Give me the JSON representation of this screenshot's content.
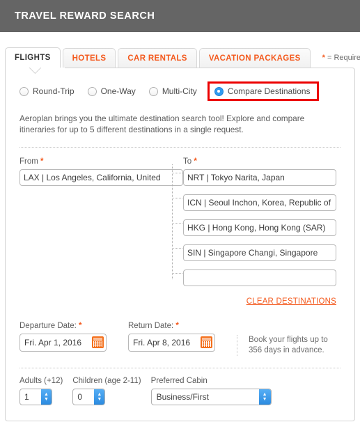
{
  "header": {
    "title": "TRAVEL REWARD SEARCH"
  },
  "tabs": [
    {
      "label": "FLIGHTS",
      "active": true
    },
    {
      "label": "HOTELS",
      "active": false
    },
    {
      "label": "CAR RENTALS",
      "active": false
    },
    {
      "label": "VACATION PACKAGES",
      "active": false
    }
  ],
  "required_note": {
    "star": "*",
    "text": " = Required"
  },
  "trip_types": [
    {
      "label": "Round-Trip",
      "checked": false,
      "highlighted": false
    },
    {
      "label": "One-Way",
      "checked": false,
      "highlighted": false
    },
    {
      "label": "Multi-City",
      "checked": false,
      "highlighted": false
    },
    {
      "label": "Compare Destinations",
      "checked": true,
      "highlighted": true
    }
  ],
  "intro_text": "Aeroplan brings you the ultimate destination search tool! Explore and compare itineraries for up to 5 different destinations in a single request.",
  "from": {
    "label": "From",
    "star": "*",
    "value": "LAX | Los Angeles, California, United",
    "placeholder": ""
  },
  "to": {
    "label": "To",
    "star": "*",
    "destinations": [
      {
        "value": "NRT | Tokyo Narita, Japan",
        "placeholder": ""
      },
      {
        "value": "ICN | Seoul Inchon, Korea, Republic of",
        "placeholder": ""
      },
      {
        "value": "HKG | Hong Kong, Hong Kong (SAR)",
        "placeholder": ""
      },
      {
        "value": "SIN | Singapore Changi, Singapore",
        "placeholder": ""
      },
      {
        "value": "",
        "placeholder": ""
      }
    ],
    "clear_link": "CLEAR DESTINATIONS"
  },
  "departure": {
    "label": "Departure Date:",
    "star": "*",
    "value": "Fri. Apr 1, 2016"
  },
  "return": {
    "label": "Return Date:",
    "star": "*",
    "value": "Fri. Apr 8, 2016"
  },
  "date_note": "Book your flights up to 356 days in advance.",
  "adults": {
    "label": "Adults (+12)",
    "value": "1"
  },
  "children": {
    "label": "Children (age 2-11)",
    "value": "0"
  },
  "cabin": {
    "label": "Preferred Cabin",
    "value": "Business/First"
  },
  "colors": {
    "header_bg": "#656565",
    "accent_orange": "#f4591d",
    "highlight_red": "#ec0000",
    "control_blue": "#2f9bf0",
    "calendar_orange": "#f4701d"
  }
}
